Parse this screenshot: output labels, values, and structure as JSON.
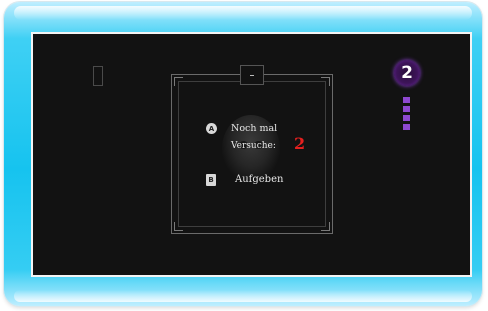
{
  "dialog": {
    "retry_button_glyph": "A",
    "retry_label": "Noch mal",
    "tries_label": "Versuche:",
    "tries_remaining": "2",
    "giveup_button_glyph": "B",
    "giveup_label": "Aufgeben"
  },
  "hud": {
    "lives_count": "2",
    "pips_total": 4,
    "pips_filled": 4
  },
  "colors": {
    "frame_cyan": "#16c3ef",
    "screen_bg": "#121212",
    "tries_red": "#e4201f",
    "lives_purple": "#8e48d0"
  },
  "icons": {
    "retry_button": "a-button-icon",
    "giveup_button": "b-button-icon",
    "skull": "skull-icon",
    "lives": "lives-badge-icon"
  }
}
